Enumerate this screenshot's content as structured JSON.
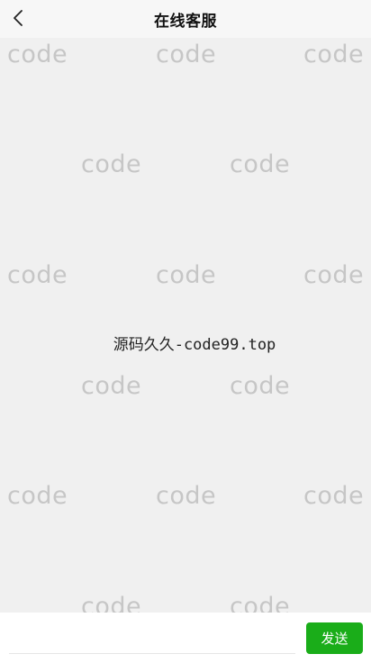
{
  "header": {
    "title": "在线客服",
    "back_icon": "chevron-left-icon"
  },
  "chat": {
    "watermark_text": "code",
    "notice": "源码久久-code99.top"
  },
  "composer": {
    "input_value": "",
    "send_label": "发送",
    "send_color": "#1aad19"
  }
}
